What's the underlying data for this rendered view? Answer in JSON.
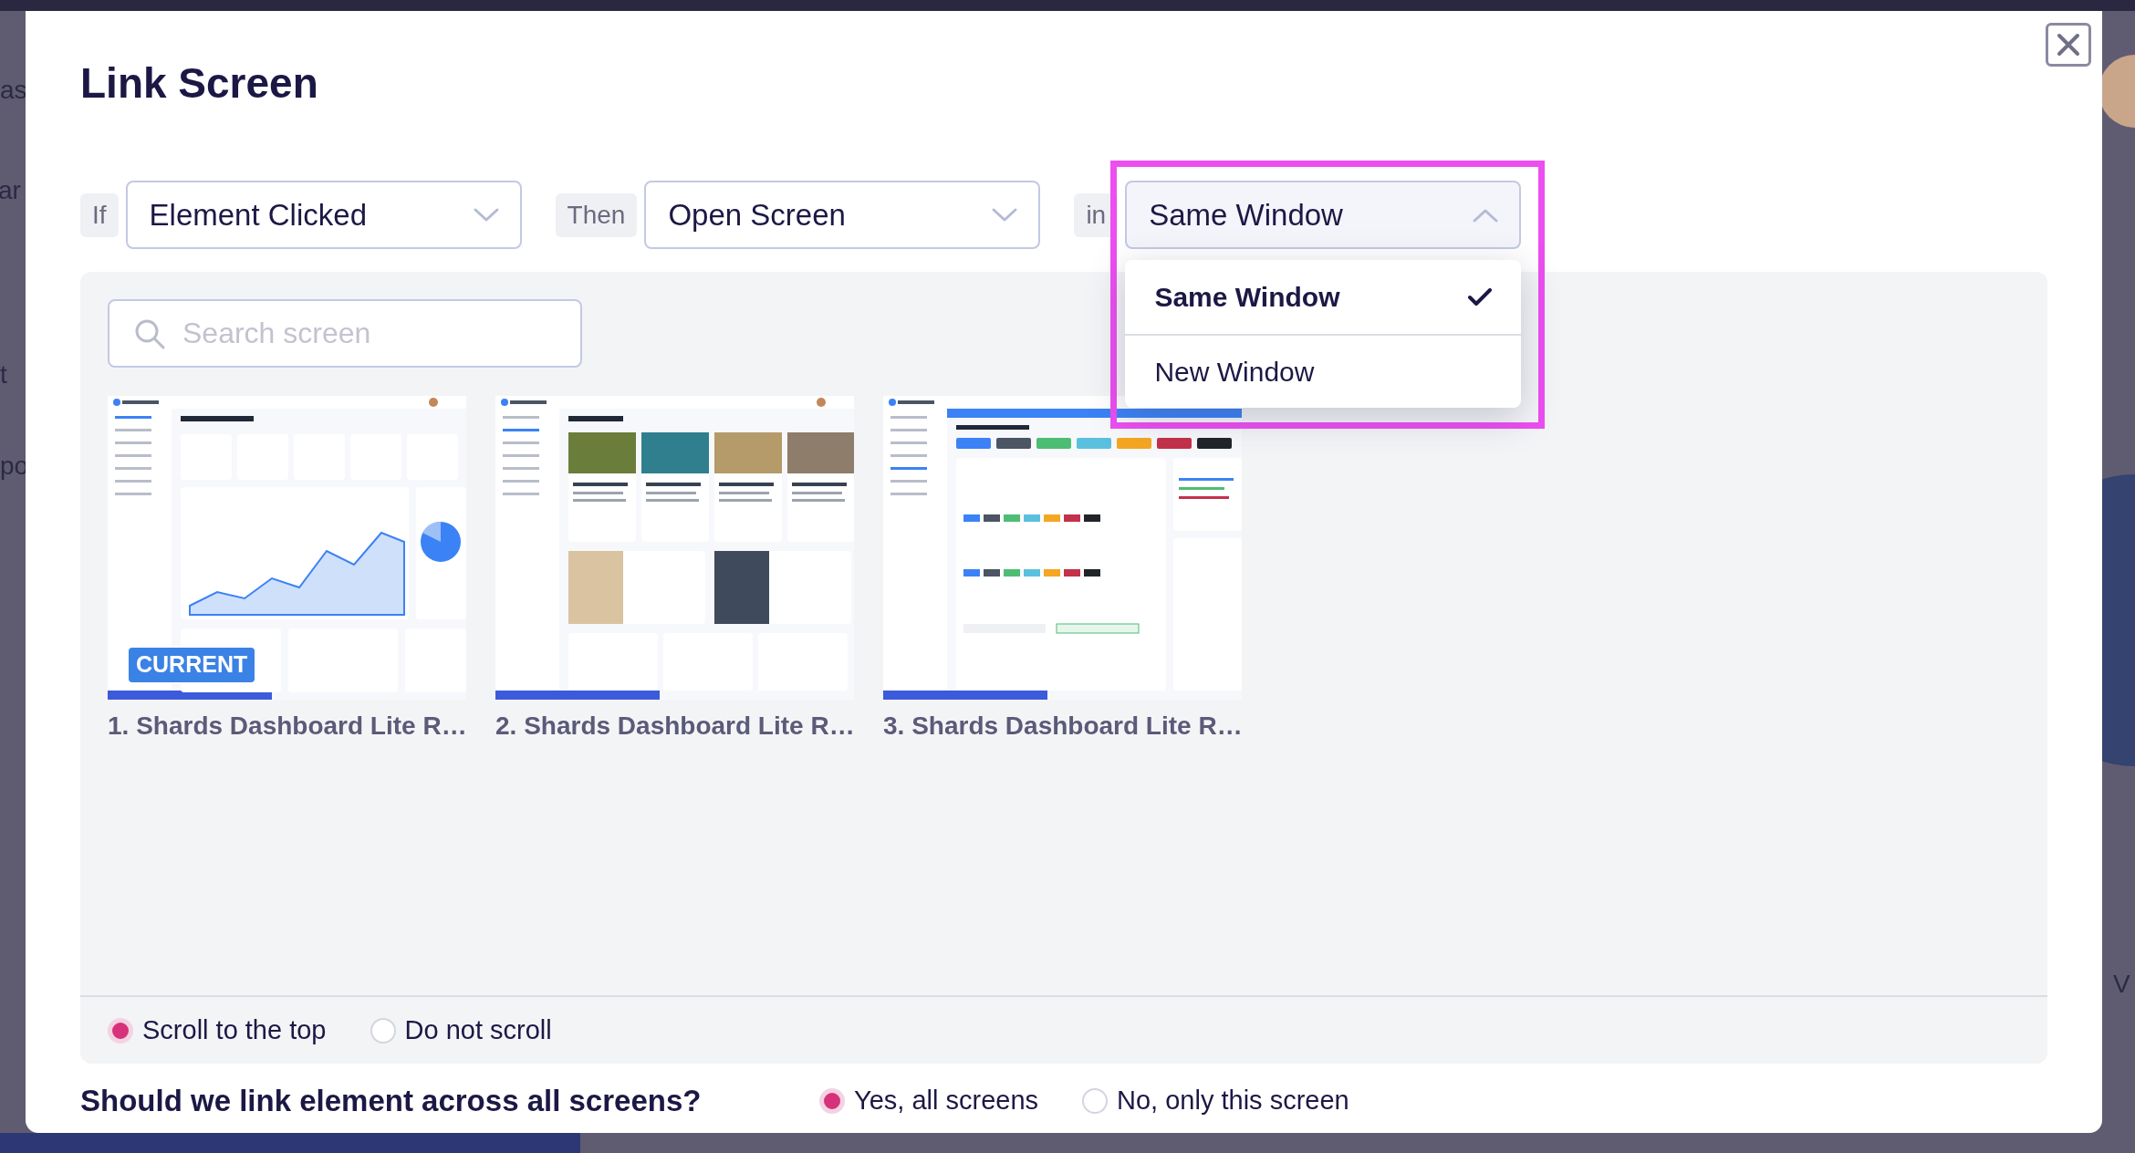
{
  "background": {
    "fragments": [
      "as",
      "ar",
      "t",
      "po",
      "V"
    ]
  },
  "dialog": {
    "title": "Link Screen",
    "conditions": [
      {
        "label": "If",
        "value": "Element Clicked",
        "expanded": false
      },
      {
        "label": "Then",
        "value": "Open Screen",
        "expanded": false
      },
      {
        "label": "in",
        "value": "Same Window",
        "expanded": true,
        "options": [
          {
            "label": "Same Window",
            "selected": true
          },
          {
            "label": "New Window",
            "selected": false
          }
        ]
      }
    ],
    "search": {
      "placeholder": "Search screen"
    },
    "screens": [
      {
        "kind": "dashboard",
        "label": "1. Shards Dashboard Lite R…",
        "badge": "CURRENT"
      },
      {
        "kind": "posts",
        "label": "2. Shards Dashboard Lite R…"
      },
      {
        "kind": "forms",
        "label": "3. Shards Dashboard Lite R…"
      }
    ],
    "scroll_options": [
      {
        "label": "Scroll to the top",
        "selected": true
      },
      {
        "label": "Do not scroll",
        "selected": false
      }
    ],
    "link_question": {
      "text": "Should we link element across all screens?",
      "options": [
        {
          "label": "Yes, all screens",
          "selected": true
        },
        {
          "label": "No, only this screen",
          "selected": false
        }
      ]
    }
  }
}
